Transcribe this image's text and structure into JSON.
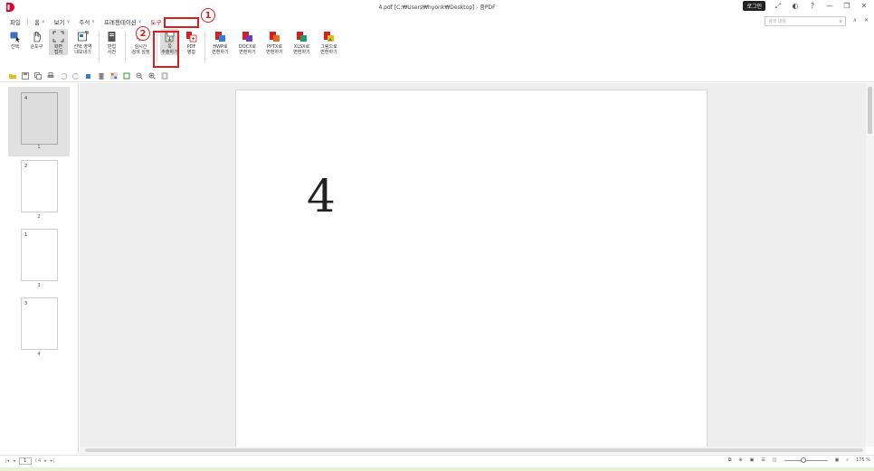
{
  "window": {
    "title": "4.pdf [C:₩Users₩hyonk₩Desktop] - 줌PDF",
    "login_label": "로그인"
  },
  "menu": {
    "items": [
      {
        "label": "파일",
        "caret": ""
      },
      {
        "label": "홈",
        "caret": "∨"
      },
      {
        "label": "보기",
        "caret": "∨"
      },
      {
        "label": "주석",
        "caret": "∨"
      },
      {
        "label": "프레젠테이션",
        "caret": "∨"
      },
      {
        "label": "도구",
        "caret": "∨"
      }
    ],
    "search_placeholder": "검색 내용"
  },
  "ribbon": {
    "buttons": [
      {
        "label": "선택"
      },
      {
        "label": "손도구"
      },
      {
        "label": "화면\n캡처"
      },
      {
        "label": "선택 영역\n내보내기"
      },
      {
        "label": "판업\n사전"
      },
      {
        "label": "실시간\n검색 설정"
      },
      {
        "label": "쪽\n추출하기"
      },
      {
        "label": "PDF\n병합"
      },
      {
        "label": "HWP로\n변환하기"
      },
      {
        "label": "DOCX로\n변환하기"
      },
      {
        "label": "PPTX로\n변환하기"
      },
      {
        "label": "XLSX로\n변환하기"
      },
      {
        "label": "그림으로\n변환하기"
      }
    ]
  },
  "thumbnails": [
    {
      "content": "4",
      "page_number": "1"
    },
    {
      "content": "2",
      "page_number": "2"
    },
    {
      "content": "1",
      "page_number": "3"
    },
    {
      "content": "3",
      "page_number": "4"
    }
  ],
  "document": {
    "page_text": "4"
  },
  "status": {
    "current_page": "1",
    "total_pages": "/ 4",
    "zoom": "175 %"
  },
  "annotations": {
    "step1": "1",
    "step2": "2"
  },
  "colors": {
    "accent": "#d62020",
    "brand": "#e4002b"
  }
}
